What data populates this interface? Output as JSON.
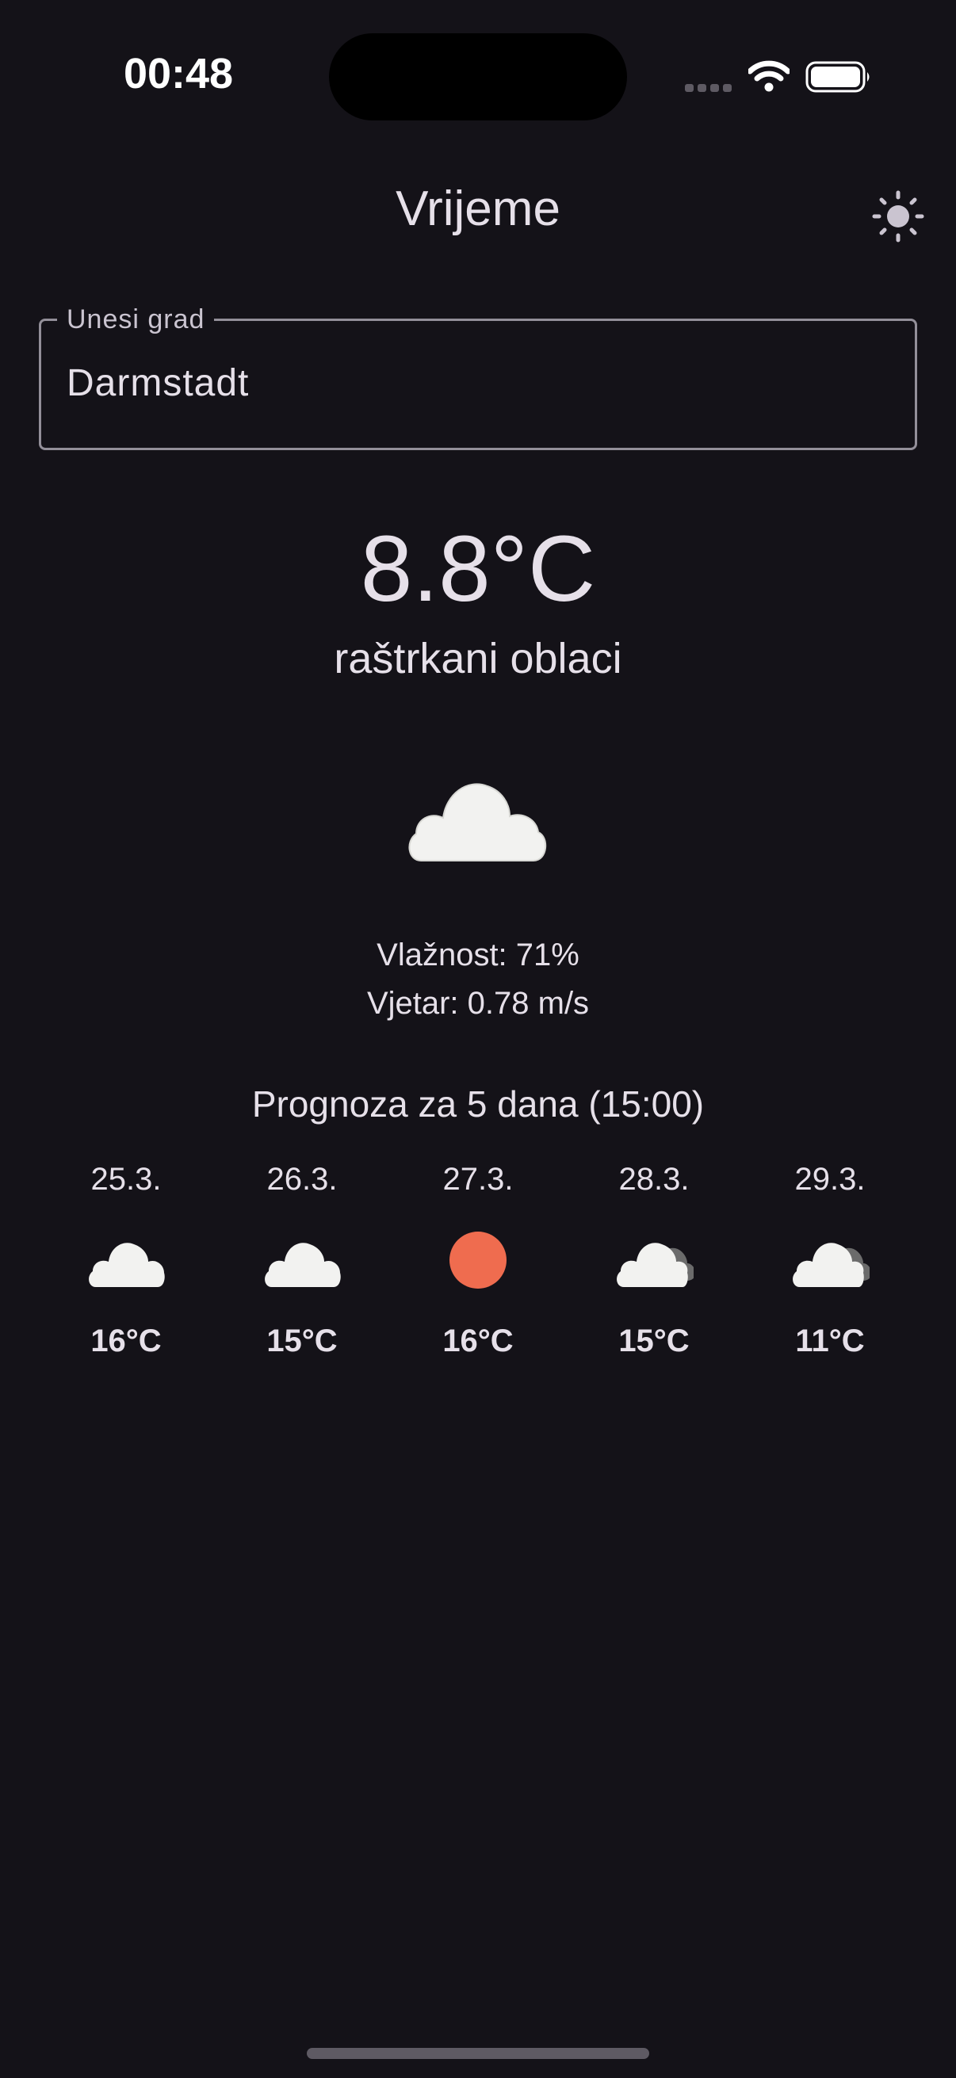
{
  "status_bar": {
    "time": "00:48"
  },
  "app_bar": {
    "title": "Vrijeme",
    "theme_toggle_icon": "sun-icon"
  },
  "city_input": {
    "label": "Unesi grad",
    "value": "Darmstadt"
  },
  "current": {
    "temperature": "8.8°C",
    "description": "raštrkani oblaci",
    "icon": "cloud-icon",
    "humidity": "Vlažnost: 71%",
    "wind": "Vjetar: 0.78 m/s"
  },
  "forecast": {
    "title": "Prognoza za 5 dana (15:00)",
    "days": [
      {
        "date": "25.3.",
        "temp": "16°C",
        "icon": "cloud-icon"
      },
      {
        "date": "26.3.",
        "temp": "15°C",
        "icon": "cloud-icon"
      },
      {
        "date": "27.3.",
        "temp": "16°C",
        "icon": "sun-icon"
      },
      {
        "date": "28.3.",
        "temp": "15°C",
        "icon": "broken-clouds-icon"
      },
      {
        "date": "29.3.",
        "temp": "11°C",
        "icon": "broken-clouds-icon"
      }
    ]
  },
  "colors": {
    "background": "#141218",
    "text": "#e6e0e9",
    "outline": "#938f99",
    "sun": "#ef6c4f",
    "cloud": "#f2f2f0",
    "cloud_dark": "#6b6b6b"
  }
}
